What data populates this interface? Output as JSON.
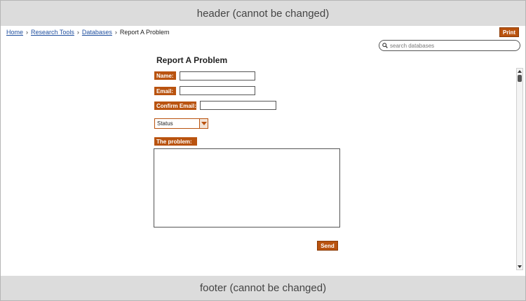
{
  "header": {
    "text": "header (cannot be changed)"
  },
  "footer": {
    "text": "footer (cannot be changed)"
  },
  "breadcrumb": {
    "items": [
      "Home",
      "Research Tools",
      "Databases"
    ],
    "current": "Report A Problem",
    "separator": "›"
  },
  "toolbar": {
    "print_label": "Print"
  },
  "search": {
    "placeholder": "search databases",
    "value": "",
    "icon": "search-icon"
  },
  "form": {
    "title": "Report A Problem",
    "name_label": "Name:",
    "name_value": "",
    "email_label": "Email:",
    "email_value": "",
    "confirm_email_label": "Confirm Email:",
    "confirm_email_value": "",
    "status_selected": "Status",
    "problem_label": "The problem:",
    "problem_value": "",
    "send_label": "Send"
  },
  "colors": {
    "accent": "#b9530f",
    "link": "#1f4f9f",
    "bar": "#dcdcdc"
  }
}
